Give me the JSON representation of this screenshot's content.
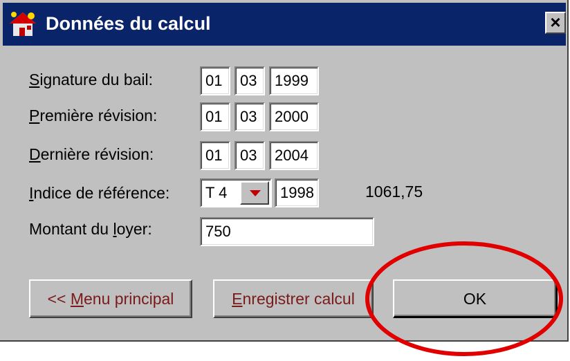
{
  "window": {
    "title": "Données du calcul",
    "close_label": "×"
  },
  "form": {
    "signature": {
      "label_first": "S",
      "label_rest": "ignature du bail:",
      "day": "01",
      "month": "03",
      "year": "1999"
    },
    "first_revision": {
      "label_first": "P",
      "label_rest": "remière révision:",
      "day": "01",
      "month": "03",
      "year": "2000"
    },
    "last_revision": {
      "label_first": "D",
      "label_rest": "ernière révision:",
      "day": "01",
      "month": "03",
      "year": "2004"
    },
    "reference_index": {
      "label_first": "I",
      "label_rest": "ndice de référence:",
      "quarter": "T 4",
      "year": "1998",
      "value": "1061,75"
    },
    "rent": {
      "label_pre": "Montant du ",
      "label_accel": "l",
      "label_post": "oyer:",
      "value": "750"
    }
  },
  "buttons": {
    "menu_pre": "<< ",
    "menu_accel": "M",
    "menu_post": "enu principal",
    "save_accel": "E",
    "save_post": "nregistrer calcul",
    "ok": "OK"
  },
  "colors": {
    "titlebar": "#0a246a",
    "dialog": "#c0c0c0",
    "highlight_ellipse": "#e00000"
  },
  "icons": {
    "app": "house-icon",
    "close": "close-icon",
    "dropdown": "chevron-down-icon"
  }
}
